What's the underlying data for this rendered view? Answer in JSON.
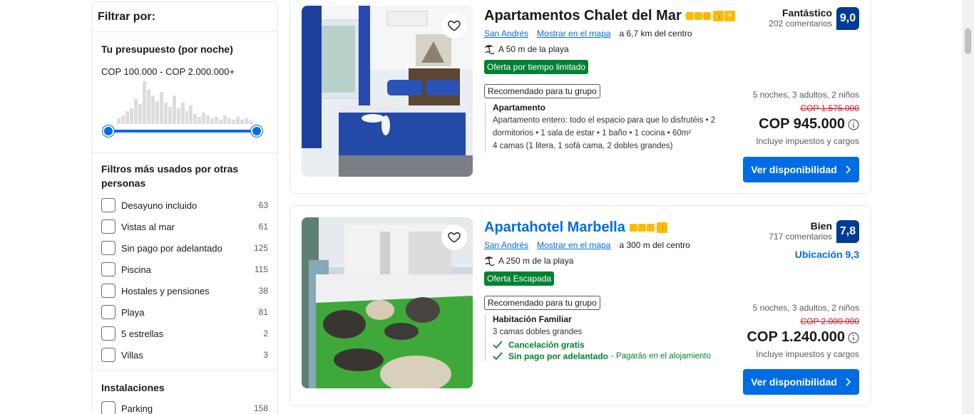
{
  "sidebar": {
    "title": "Filtrar por:",
    "budget": {
      "heading": "Tu presupuesto (por noche)",
      "range": "COP 100.000 - COP 2.000.000+",
      "histogram": [
        8,
        12,
        18,
        22,
        35,
        28,
        60,
        48,
        40,
        32,
        45,
        30,
        24,
        40,
        22,
        30,
        18,
        26,
        14,
        10,
        16,
        12,
        8,
        10,
        6,
        12,
        8,
        6,
        10,
        6,
        8,
        5
      ]
    },
    "popular": {
      "heading": "Filtros más usados por otras personas",
      "items": [
        {
          "label": "Desayuno incluido",
          "count": "63"
        },
        {
          "label": "Vistas al mar",
          "count": "61"
        },
        {
          "label": "Sin pago por adelantado",
          "count": "125"
        },
        {
          "label": "Piscina",
          "count": "115"
        },
        {
          "label": "Hostales y pensiones",
          "count": "38"
        },
        {
          "label": "Playa",
          "count": "81"
        },
        {
          "label": "5 estrellas",
          "count": "2"
        },
        {
          "label": "Villas",
          "count": "3"
        }
      ]
    },
    "facilities": {
      "heading": "Instalaciones",
      "items": [
        {
          "label": "Parking",
          "count": "158"
        }
      ]
    }
  },
  "properties": [
    {
      "name": "Apartamentos Chalet del Mar",
      "area": "San Andrés",
      "map_link": "Mostrar en el mapa",
      "distance": "a 6,7 km del centro",
      "beach": "A 50 m de la playa",
      "deal": "Oferta por tiempo limitado",
      "recommended": "Recomendado para tu grupo",
      "unit_name": "Apartamento",
      "unit_desc": "Apartamento entero: todo el espacio para que lo disfrutéis • 2 dormitorios • 1 sala de estar • 1 baño • 1 cocina • 60m²",
      "beds": "4 camas (1 litera, 1 sofá cama, 2 dobles grandes)",
      "rating_word": "Fantástico",
      "reviews": "202 comentarios",
      "score": "9,0",
      "stay": "5 noches, 3 adultos, 2 niños",
      "old_price": "COP 1.575.000",
      "price": "COP 945.000",
      "tax": "Incluye impuestos y cargos",
      "cta": "Ver disponibilidad"
    },
    {
      "name": "Apartahotel Marbella",
      "area": "San Andrés",
      "map_link": "Mostrar en el mapa",
      "distance": "a 300 m del centro",
      "beach": "A 250 m de la playa",
      "deal": "Oferta Escapada",
      "recommended": "Recomendado para tu grupo",
      "unit_name": "Habitación Familiar",
      "beds": "3 camas dobles grandes",
      "perk1": "Cancelación gratis",
      "perk2": "Sin pago por adelantado",
      "perk2_sub": "- Pagarás en el alojamiento",
      "rating_word": "Bien",
      "reviews": "717 comentarios",
      "score": "7,8",
      "location_score": "Ubicación 9,3",
      "stay": "5 noches, 3 adultos, 2 niños",
      "old_price": "COP 2.000.000",
      "price": "COP 1.240.000",
      "tax": "Incluye impuestos y cargos",
      "cta": "Ver disponibilidad"
    }
  ],
  "colors": {
    "accent": "#006ce4",
    "score_bg": "#003b95",
    "deal_bg": "#008234",
    "star": "#febb02",
    "strike": "#d4111e"
  }
}
